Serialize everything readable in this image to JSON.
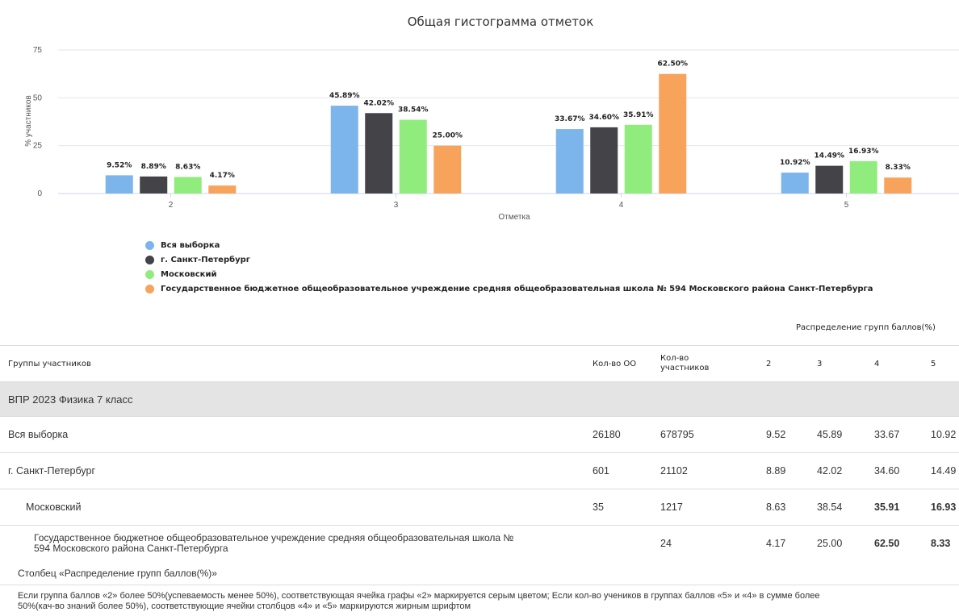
{
  "chart_data": {
    "type": "bar",
    "title": "Общая гистограмма отметок",
    "xlabel": "Отметка",
    "ylabel": "% участников",
    "categories": [
      "2",
      "3",
      "4",
      "5"
    ],
    "ylim": [
      0,
      75
    ],
    "yticks": [
      0,
      25,
      50,
      75
    ],
    "legend_position": "bottom-left",
    "series": [
      {
        "name": "Вся выборка",
        "color": "#7cb5ec",
        "values": [
          9.52,
          45.89,
          33.67,
          10.92
        ],
        "labels": [
          "9.52%",
          "45.89%",
          "33.67%",
          "10.92%"
        ]
      },
      {
        "name": "г. Санкт-Петербург",
        "color": "#434348",
        "values": [
          8.89,
          42.02,
          34.6,
          14.49
        ],
        "labels": [
          "8.89%",
          "42.02%",
          "34.60%",
          "14.49%"
        ]
      },
      {
        "name": "Московский",
        "color": "#90ed7d",
        "values": [
          8.63,
          38.54,
          35.91,
          16.93
        ],
        "labels": [
          "8.63%",
          "38.54%",
          "35.91%",
          "16.93%"
        ]
      },
      {
        "name": "Государственное бюджетное общеобразовательное учреждение средняя общеобразовательная школа № 594 Московского района Санкт-Петербурга",
        "color": "#f7a35c",
        "values": [
          4.17,
          25.0,
          62.5,
          8.33
        ],
        "labels": [
          "4.17%",
          "25.00%",
          "62.50%",
          "8.33%"
        ]
      }
    ]
  },
  "table": {
    "distribution_header": "Распределение групп баллов(%)",
    "headers": {
      "groups": "Группы участников",
      "oo_count": "Кол-во ОО",
      "participants_line1": "Кол-во",
      "participants_line2": "участников",
      "g2": "2",
      "g3": "3",
      "g4": "4",
      "g5": "5"
    },
    "group_title": "ВПР 2023 Физика 7 класс",
    "rows": [
      {
        "name": "Вся выборка",
        "oo": "26180",
        "participants": "678795",
        "g2": "9.52",
        "g3": "45.89",
        "g4": "33.67",
        "g5": "10.92"
      },
      {
        "name": "г. Санкт-Петербург",
        "oo": "601",
        "participants": "21102",
        "g2": "8.89",
        "g3": "42.02",
        "g4": "34.60",
        "g5": "14.49"
      },
      {
        "name": "Московский",
        "oo": "35",
        "participants": "1217",
        "g2": "8.63",
        "g3": "38.54",
        "g4": "35.91",
        "g5": "16.93"
      },
      {
        "name_line1": "Государственное бюджетное общеобразовательное учреждение средняя общеобразовательная школа №",
        "name_line2": "594 Московского района Санкт-Петербурга",
        "oo": "",
        "participants": "24",
        "g2": "4.17",
        "g3": "25.00",
        "g4": "62.50",
        "g5": "8.33"
      }
    ]
  },
  "notes": {
    "title": "Столбец «Распределение групп баллов(%)»",
    "line1": "Если группа баллов «2» более 50%(успеваемость менее 50%), соответствующая ячейка графы «2» маркируется серым цветом; Если кол-во учеников в группах баллов «5» и «4» в сумме более",
    "line2": "50%(кач-во знаний более 50%), соответствующие ячейки столбцов «4» и «5» маркируются жирным шрифтом"
  }
}
